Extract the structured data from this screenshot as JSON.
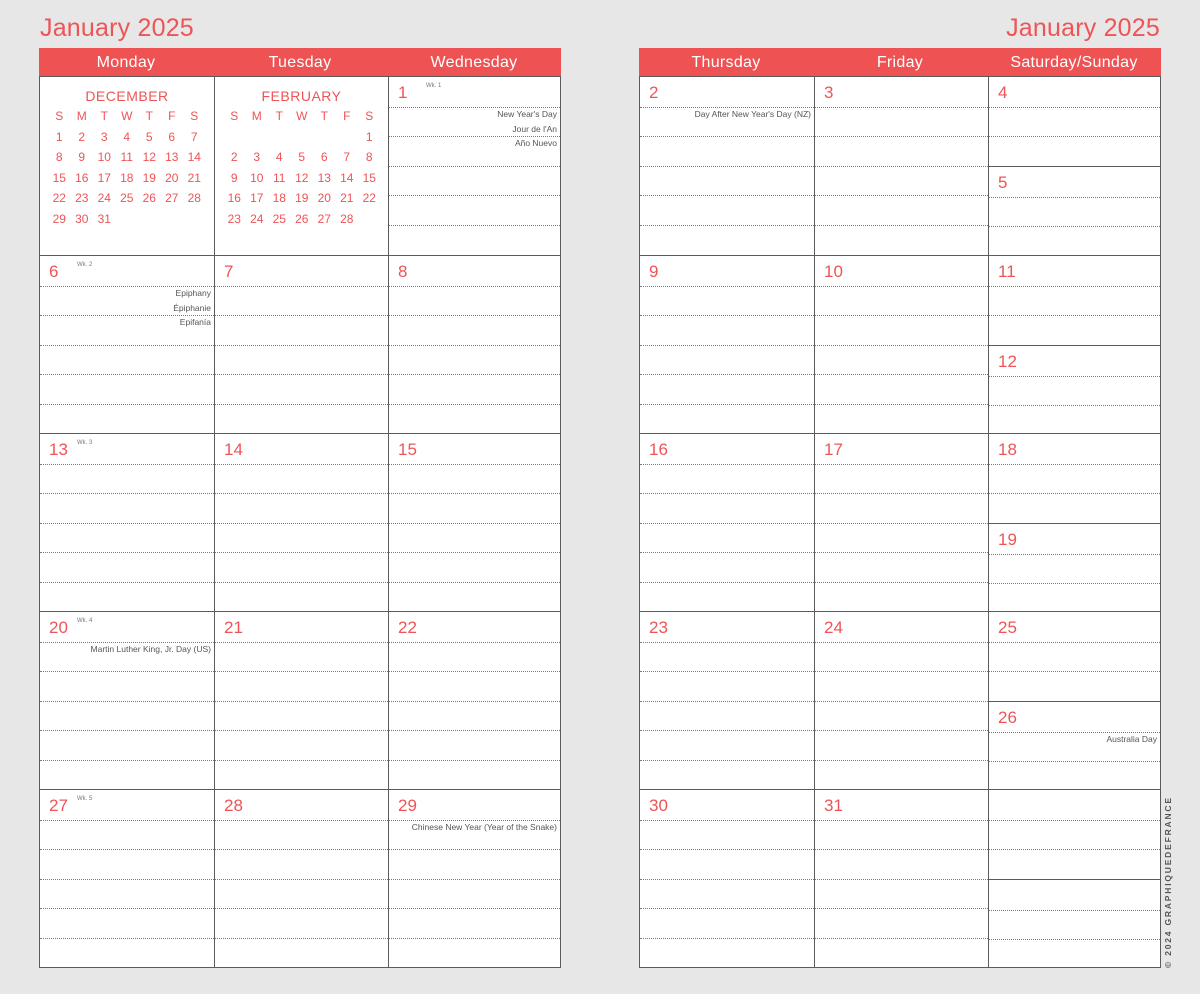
{
  "title_left": "January 2025",
  "title_right": "January 2025",
  "left_page": {
    "headers": [
      "Monday",
      "Tuesday",
      "Wednesday"
    ]
  },
  "right_page": {
    "headers": [
      "Thursday",
      "Friday",
      "Saturday/Sunday"
    ]
  },
  "mini_calendars": [
    {
      "name": "DECEMBER",
      "weekdays": [
        "S",
        "M",
        "T",
        "W",
        "T",
        "F",
        "S"
      ],
      "days": [
        "1",
        "2",
        "3",
        "4",
        "5",
        "6",
        "7",
        "8",
        "9",
        "10",
        "11",
        "12",
        "13",
        "14",
        "15",
        "16",
        "17",
        "18",
        "19",
        "20",
        "21",
        "22",
        "23",
        "24",
        "25",
        "26",
        "27",
        "28",
        "29",
        "30",
        "31"
      ],
      "offset": 0
    },
    {
      "name": "FEBRUARY",
      "weekdays": [
        "S",
        "M",
        "T",
        "W",
        "T",
        "F",
        "S"
      ],
      "days": [
        "1",
        "2",
        "3",
        "4",
        "5",
        "6",
        "7",
        "8",
        "9",
        "10",
        "11",
        "12",
        "13",
        "14",
        "15",
        "16",
        "17",
        "18",
        "19",
        "20",
        "21",
        "22",
        "23",
        "24",
        "25",
        "26",
        "27",
        "28"
      ],
      "offset": 6
    }
  ],
  "weeks": [
    {
      "week_label": "Wk. 1",
      "mon": null,
      "tue": null,
      "wed": {
        "day": "1",
        "holidays": [
          "New Year's Day",
          "Jour de l'An",
          "Año Nuevo"
        ]
      },
      "thu": {
        "day": "2",
        "holidays": [
          "Day After New Year's Day (NZ)"
        ]
      },
      "fri": {
        "day": "3",
        "holidays": []
      },
      "sat": {
        "day": "4",
        "holidays": []
      },
      "sun": {
        "day": "5",
        "holidays": []
      }
    },
    {
      "week_label": "Wk. 2",
      "mon": {
        "day": "6",
        "holidays": [
          "Epiphany",
          "Épiphanie",
          "Epifanía"
        ]
      },
      "tue": {
        "day": "7",
        "holidays": []
      },
      "wed": {
        "day": "8",
        "holidays": []
      },
      "thu": {
        "day": "9",
        "holidays": []
      },
      "fri": {
        "day": "10",
        "holidays": []
      },
      "sat": {
        "day": "11",
        "holidays": []
      },
      "sun": {
        "day": "12",
        "holidays": []
      }
    },
    {
      "week_label": "Wk. 3",
      "mon": {
        "day": "13",
        "holidays": []
      },
      "tue": {
        "day": "14",
        "holidays": []
      },
      "wed": {
        "day": "15",
        "holidays": []
      },
      "thu": {
        "day": "16",
        "holidays": []
      },
      "fri": {
        "day": "17",
        "holidays": []
      },
      "sat": {
        "day": "18",
        "holidays": []
      },
      "sun": {
        "day": "19",
        "holidays": []
      }
    },
    {
      "week_label": "Wk. 4",
      "mon": {
        "day": "20",
        "holidays": [
          "Martin Luther King, Jr. Day (US)"
        ]
      },
      "tue": {
        "day": "21",
        "holidays": []
      },
      "wed": {
        "day": "22",
        "holidays": []
      },
      "thu": {
        "day": "23",
        "holidays": []
      },
      "fri": {
        "day": "24",
        "holidays": []
      },
      "sat": {
        "day": "25",
        "holidays": []
      },
      "sun": {
        "day": "26",
        "holidays": [
          "Australia Day"
        ]
      }
    },
    {
      "week_label": "Wk. 5",
      "mon": {
        "day": "27",
        "holidays": []
      },
      "tue": {
        "day": "28",
        "holidays": []
      },
      "wed": {
        "day": "29",
        "holidays": [
          "Chinese New Year (Year of the Snake)"
        ]
      },
      "thu": {
        "day": "30",
        "holidays": []
      },
      "fri": {
        "day": "31",
        "holidays": []
      },
      "sat": null,
      "sun": null
    }
  ],
  "copyright": "© 2024 GRAPHIQUEDEFRANCE",
  "colors": {
    "accent": "#ef5253",
    "grid_line": "#5b5b5b",
    "background": "#e7e7e7"
  }
}
